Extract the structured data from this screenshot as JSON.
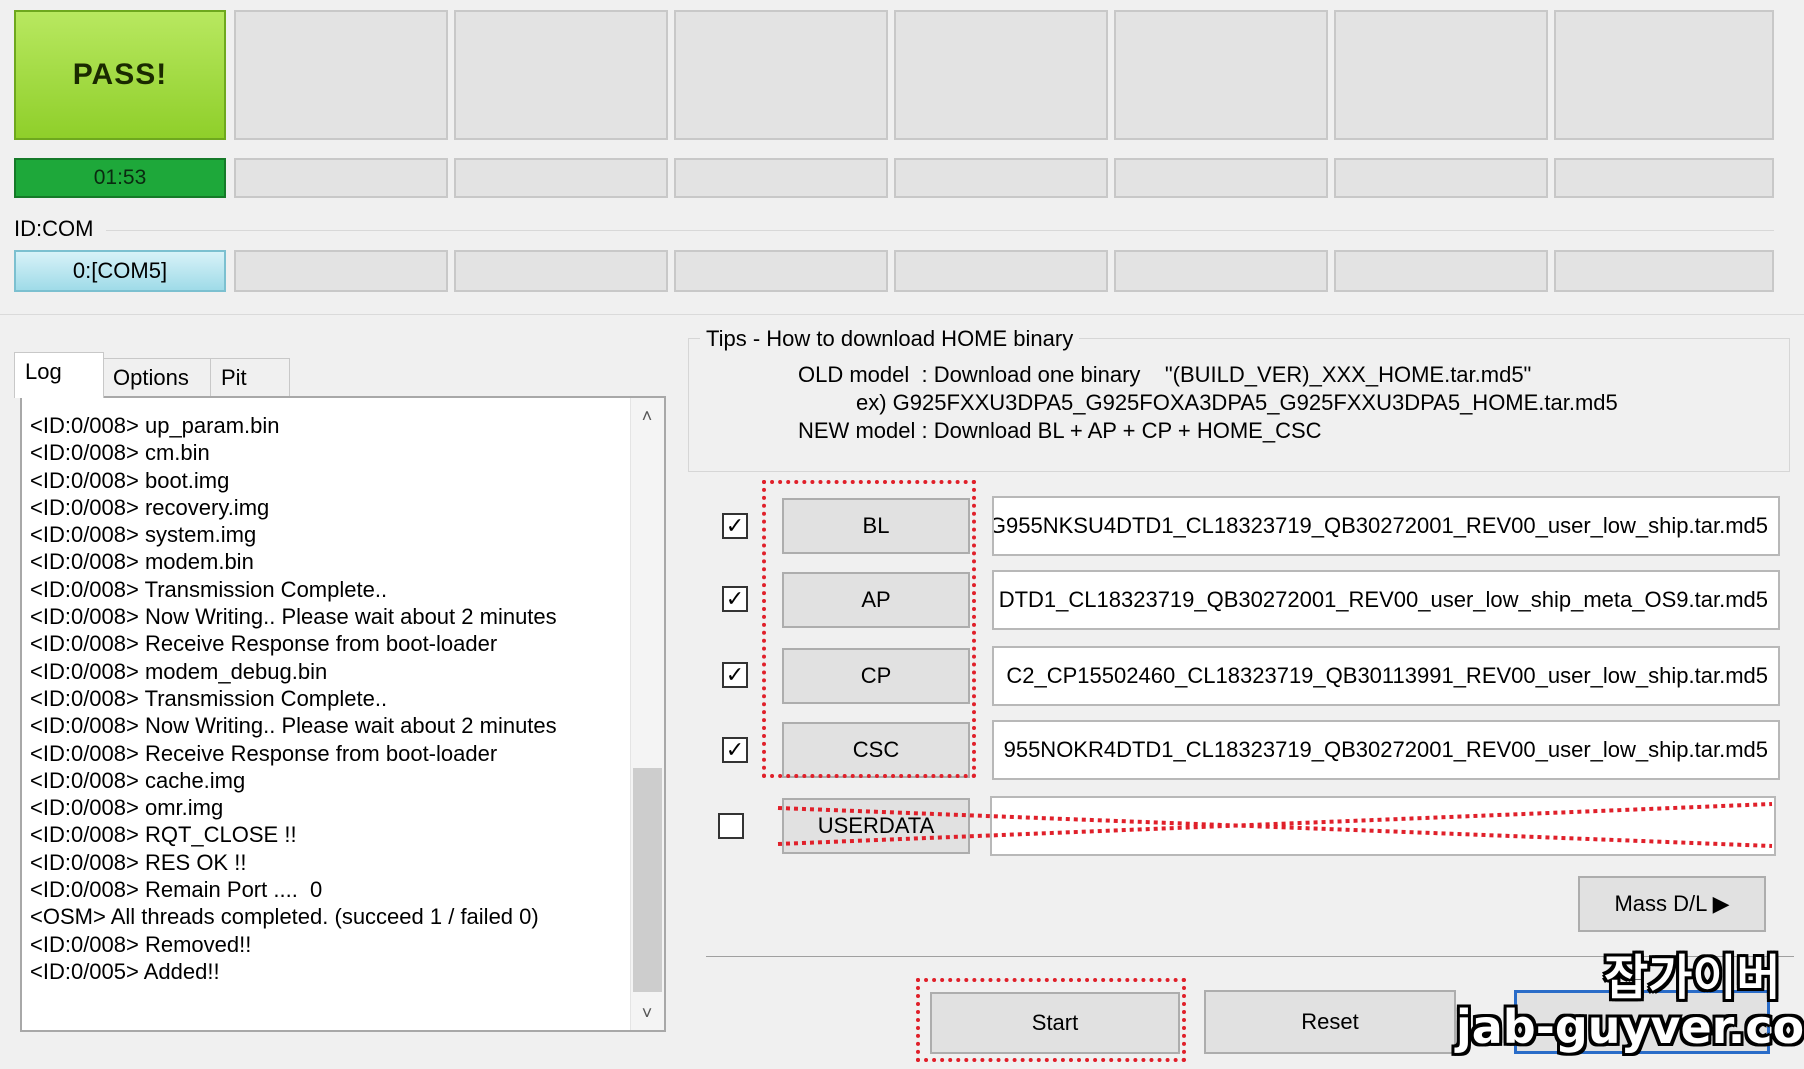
{
  "status": {
    "pass_label": "PASS!",
    "timer": "01:53",
    "id_com_label": "ID:COM",
    "com_port": "0:[COM5]"
  },
  "tabs": [
    {
      "label": "Log"
    },
    {
      "label": "Options"
    },
    {
      "label": "Pit"
    }
  ],
  "log": {
    "lines": [
      "<ID:0/008> up_param.bin",
      "<ID:0/008> cm.bin",
      "<ID:0/008> boot.img",
      "<ID:0/008> recovery.img",
      "<ID:0/008> system.img",
      "<ID:0/008> modem.bin",
      "<ID:0/008> Transmission Complete..",
      "<ID:0/008> Now Writing.. Please wait about 2 minutes",
      "<ID:0/008> Receive Response from boot-loader",
      "<ID:0/008> modem_debug.bin",
      "<ID:0/008> Transmission Complete..",
      "<ID:0/008> Now Writing.. Please wait about 2 minutes",
      "<ID:0/008> Receive Response from boot-loader",
      "<ID:0/008> cache.img",
      "<ID:0/008> omr.img",
      "<ID:0/008> RQT_CLOSE !!",
      "<ID:0/008> RES OK !!",
      "<ID:0/008> Remain Port ....  0",
      "<OSM> All threads completed. (succeed 1 / failed 0)",
      "<ID:0/008> Removed!!",
      "<ID:0/005> Added!!"
    ]
  },
  "tips": {
    "title": "Tips - How to download HOME binary",
    "line1": "OLD model  : Download one binary    \"(BUILD_VER)_XXX_HOME.tar.md5\"",
    "line2": "ex) G925FXXU3DPA5_G925FOXA3DPA5_G925FXXU3DPA5_HOME.tar.md5",
    "line3": "NEW model : Download BL + AP + CP + HOME_CSC"
  },
  "files": [
    {
      "label": "BL",
      "checked": true,
      "path": "G955NKSU4DTD1_CL18323719_QB30272001_REV00_user_low_ship.tar.md5"
    },
    {
      "label": "AP",
      "checked": true,
      "path": "DTD1_CL18323719_QB30272001_REV00_user_low_ship_meta_OS9.tar.md5"
    },
    {
      "label": "CP",
      "checked": true,
      "path": "C2_CP15502460_CL18323719_QB30113991_REV00_user_low_ship.tar.md5"
    },
    {
      "label": "CSC",
      "checked": true,
      "path": "955NOKR4DTD1_CL18323719_QB30272001_REV00_user_low_ship.tar.md5"
    },
    {
      "label": "USERDATA",
      "checked": false,
      "path": ""
    }
  ],
  "buttons": {
    "mass_dl": "Mass D/L ▶",
    "start": "Start",
    "reset": "Reset"
  },
  "watermark": {
    "korean": "잡가이버",
    "site": "jab-guyver.co.kr"
  },
  "colors": {
    "pass": "#8fcf2a",
    "timer": "#1ea83a",
    "com": "#9fdbe8",
    "annotation": "#e0202a"
  }
}
